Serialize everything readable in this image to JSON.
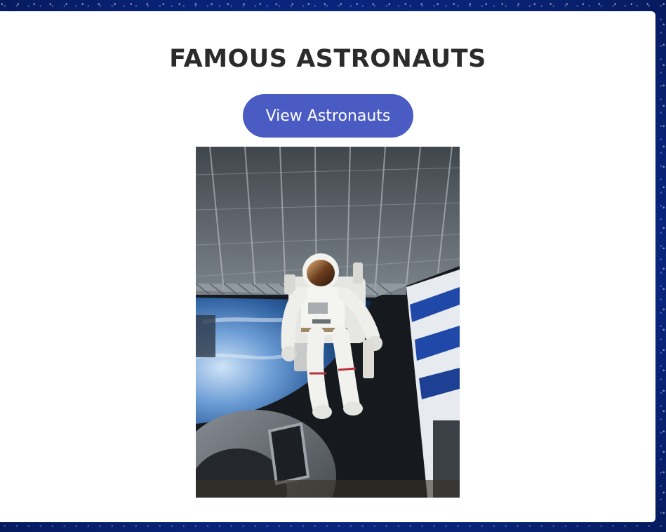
{
  "page": {
    "title": "FAMOUS ASTRONAUTS",
    "button_label": "View Astronauts"
  },
  "colors": {
    "button": "#4a5bc4",
    "card": "#ffffff",
    "background": "#0b2a8c",
    "title": "#2b2b2b"
  },
  "image": {
    "subject": "astronaut-photo"
  }
}
